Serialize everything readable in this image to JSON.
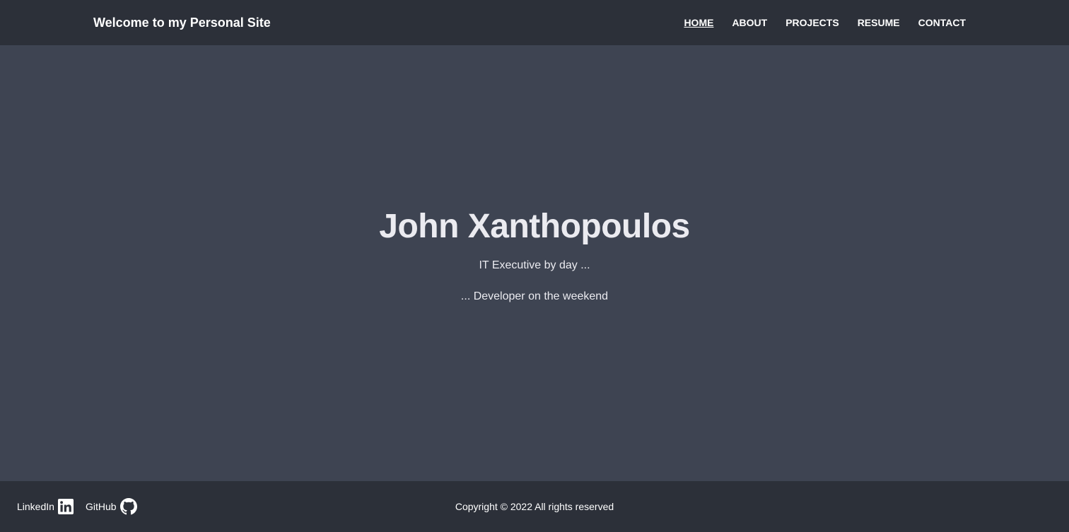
{
  "header": {
    "brand": "Welcome to my Personal Site",
    "nav": [
      {
        "label": "HOME",
        "active": true
      },
      {
        "label": "ABOUT",
        "active": false
      },
      {
        "label": "PROJECTS",
        "active": false
      },
      {
        "label": "RESUME",
        "active": false
      },
      {
        "label": "CONTACT",
        "active": false
      }
    ]
  },
  "hero": {
    "name": "John Xanthopoulos",
    "tagline_1": "IT Executive by day ...",
    "tagline_2": "... Developer on the weekend"
  },
  "footer": {
    "social": [
      {
        "label": "LinkedIn",
        "icon": "linkedin-icon"
      },
      {
        "label": "GitHub",
        "icon": "github-icon"
      }
    ],
    "copyright": "Copyright © 2022 All rights reserved"
  },
  "colors": {
    "header_bg": "#2c3039",
    "hero_bg": "#3e4452",
    "footer_bg": "#2c3039",
    "text": "#ffffff"
  }
}
